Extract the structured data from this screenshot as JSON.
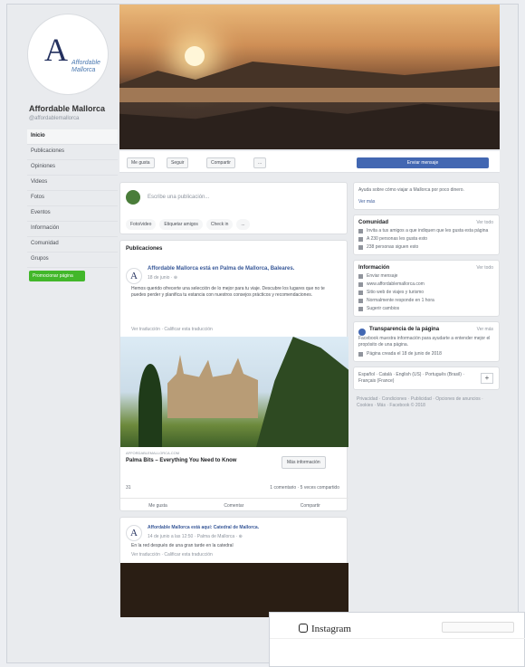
{
  "sidebar": {
    "page_name": "Affordable Mallorca",
    "handle": "@affordablemallorca",
    "logo_letter": "A",
    "logo_wordmark": "Affordable Mallorca",
    "nav": [
      "Inicio",
      "Publicaciones",
      "Opiniones",
      "Videos",
      "Fotos",
      "Eventos",
      "Información",
      "Comunidad",
      "Grupos"
    ],
    "promote_label": "Promocionar página"
  },
  "actionbar": {
    "like": "Me gusta",
    "follow": "Seguir",
    "share": "Compartir",
    "more": "...",
    "send": "Enviar mensaje"
  },
  "composer": {
    "placeholder": "Escribe una publicación...",
    "pills": [
      "Foto/video",
      "Etiquetar amigos",
      "Check in",
      "..."
    ]
  },
  "feed": {
    "header": "Publicaciones",
    "post1": {
      "avatar_letter": "A",
      "author": "Affordable Mallorca está en Palma de Mallorca, Baleares.",
      "time": "18 de junio · ⊕",
      "text": "Hemos querido ofrecerte una selección de lo mejor para tu viaje. Descubre los lugares que no te puedes perder y planifica tu estancia con nuestros consejos prácticos y recomendaciones.",
      "see_translation": "Ver traducción · Calificar esta traducción",
      "link_domain": "AFFORDABLEMALLORCA.COM",
      "link_title": "Palma Bits – Everything You Need to Know",
      "more_info": "Más información",
      "reactions": "31",
      "comments_shares": "1 comentario · 5 veces compartido",
      "actions": [
        "Me gusta",
        "Comentar",
        "Compartir"
      ]
    },
    "post2": {
      "avatar_letter": "A",
      "author": "Affordable Mallorca está aquí: Catedral de Mallorca.",
      "time": "14 de junio a las 12:50 · Palma de Mallorca · ⊕",
      "text": "En la red después de una gran tarde en la catedral",
      "see_translation": "Ver traducción · Calificar esta traducción"
    }
  },
  "right": {
    "help": {
      "text": "Ayuda sobre cómo viajar a Mallorca por poco dinero.",
      "link": "Ver más"
    },
    "community": {
      "title": "Comunidad",
      "action": "Ver todo",
      "rows": [
        "Invita a tus amigos a que indiquen que les gusta esta página",
        "A 230 personas les gusta esto",
        "238 personas siguen esto"
      ]
    },
    "info": {
      "title": "Información",
      "action": "Ver todo",
      "rows": [
        "Enviar mensaje",
        "www.affordablemallorca.com",
        "Sitio web de viajes y turismo",
        "Normalmente responde en 1 hora",
        "Sugerir cambios"
      ]
    },
    "transparency": {
      "title": "Transparencia de la página",
      "action": "Ver más",
      "text": "Facebook muestra información para ayudarte a entender mejor el propósito de una página.",
      "row": "Página creada el 18 de junio de 2018"
    },
    "lang": {
      "text": "Español · Català · English (US) · Português (Brasil) · Français (France)",
      "plus": "+"
    },
    "footer": "Privacidad · Condiciones · Publicidad · Opciones de anuncios · Cookies · Más · Facebook © 2018"
  },
  "overlay": {
    "brand": "Instagram"
  }
}
